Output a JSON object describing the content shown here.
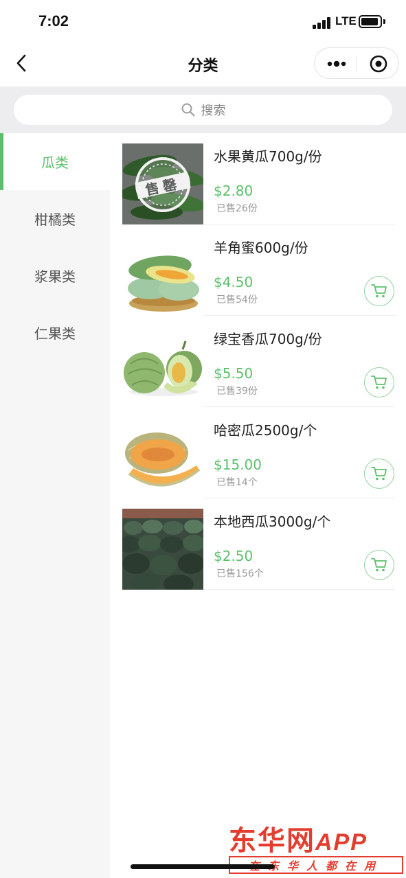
{
  "status_bar": {
    "time": "7:02",
    "network": "LTE"
  },
  "nav": {
    "title": "分类"
  },
  "search": {
    "placeholder": "搜索"
  },
  "categories": [
    {
      "label": "瓜类",
      "active": true
    },
    {
      "label": "柑橘类",
      "active": false
    },
    {
      "label": "浆果类",
      "active": false
    },
    {
      "label": "仁果类",
      "active": false
    }
  ],
  "products": [
    {
      "name": "水果黄瓜700g/份",
      "price": "$2.80",
      "sold": "已售26份",
      "sold_out": true,
      "sold_out_stamp": "售罄"
    },
    {
      "name": "羊角蜜600g/份",
      "price": "$4.50",
      "sold": "已售54份",
      "sold_out": false
    },
    {
      "name": "绿宝香瓜700g/份",
      "price": "$5.50",
      "sold": "已售39份",
      "sold_out": false
    },
    {
      "name": "哈密瓜2500g/个",
      "price": "$15.00",
      "sold": "已售14个",
      "sold_out": false
    },
    {
      "name": "本地西瓜3000g/个",
      "price": "$2.50",
      "sold": "已售156个",
      "sold_out": false
    }
  ],
  "watermark": {
    "title": "东华网",
    "app": "APP",
    "slogan": "在东华人都在用"
  },
  "colors": {
    "accent": "#5cc06b",
    "watermark": "#e43d2e"
  }
}
